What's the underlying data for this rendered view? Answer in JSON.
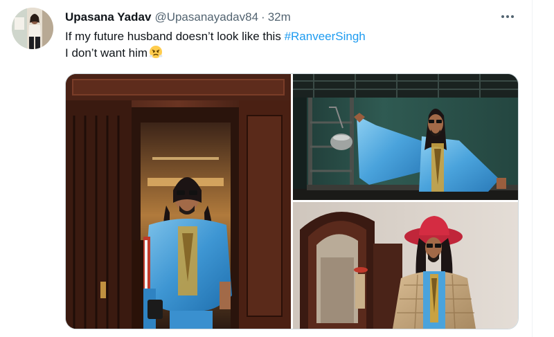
{
  "tweet": {
    "author": {
      "display_name": "Upasana Yadav",
      "handle": "@Upasanayadav84",
      "avatar_icon": "profile-photo"
    },
    "separator": "·",
    "timestamp": "32m",
    "more_icon": "ellipsis-icon",
    "text": {
      "line1_prefix": "If my future husband doesn’t look like this ",
      "hashtag": "#RanveerSingh",
      "line2": "I don’t want him",
      "emoji": "face-with-steam-from-nose"
    },
    "media": [
      {
        "name": "photo-elevator",
        "icon": "photo"
      },
      {
        "name": "photo-bunk-bed",
        "icon": "photo"
      },
      {
        "name": "photo-red-hat-mirror",
        "icon": "photo"
      }
    ]
  },
  "colors": {
    "text_primary": "#0f1419",
    "text_secondary": "#536471",
    "hashtag": "#1d9bf0",
    "border": "#cfd9de"
  }
}
